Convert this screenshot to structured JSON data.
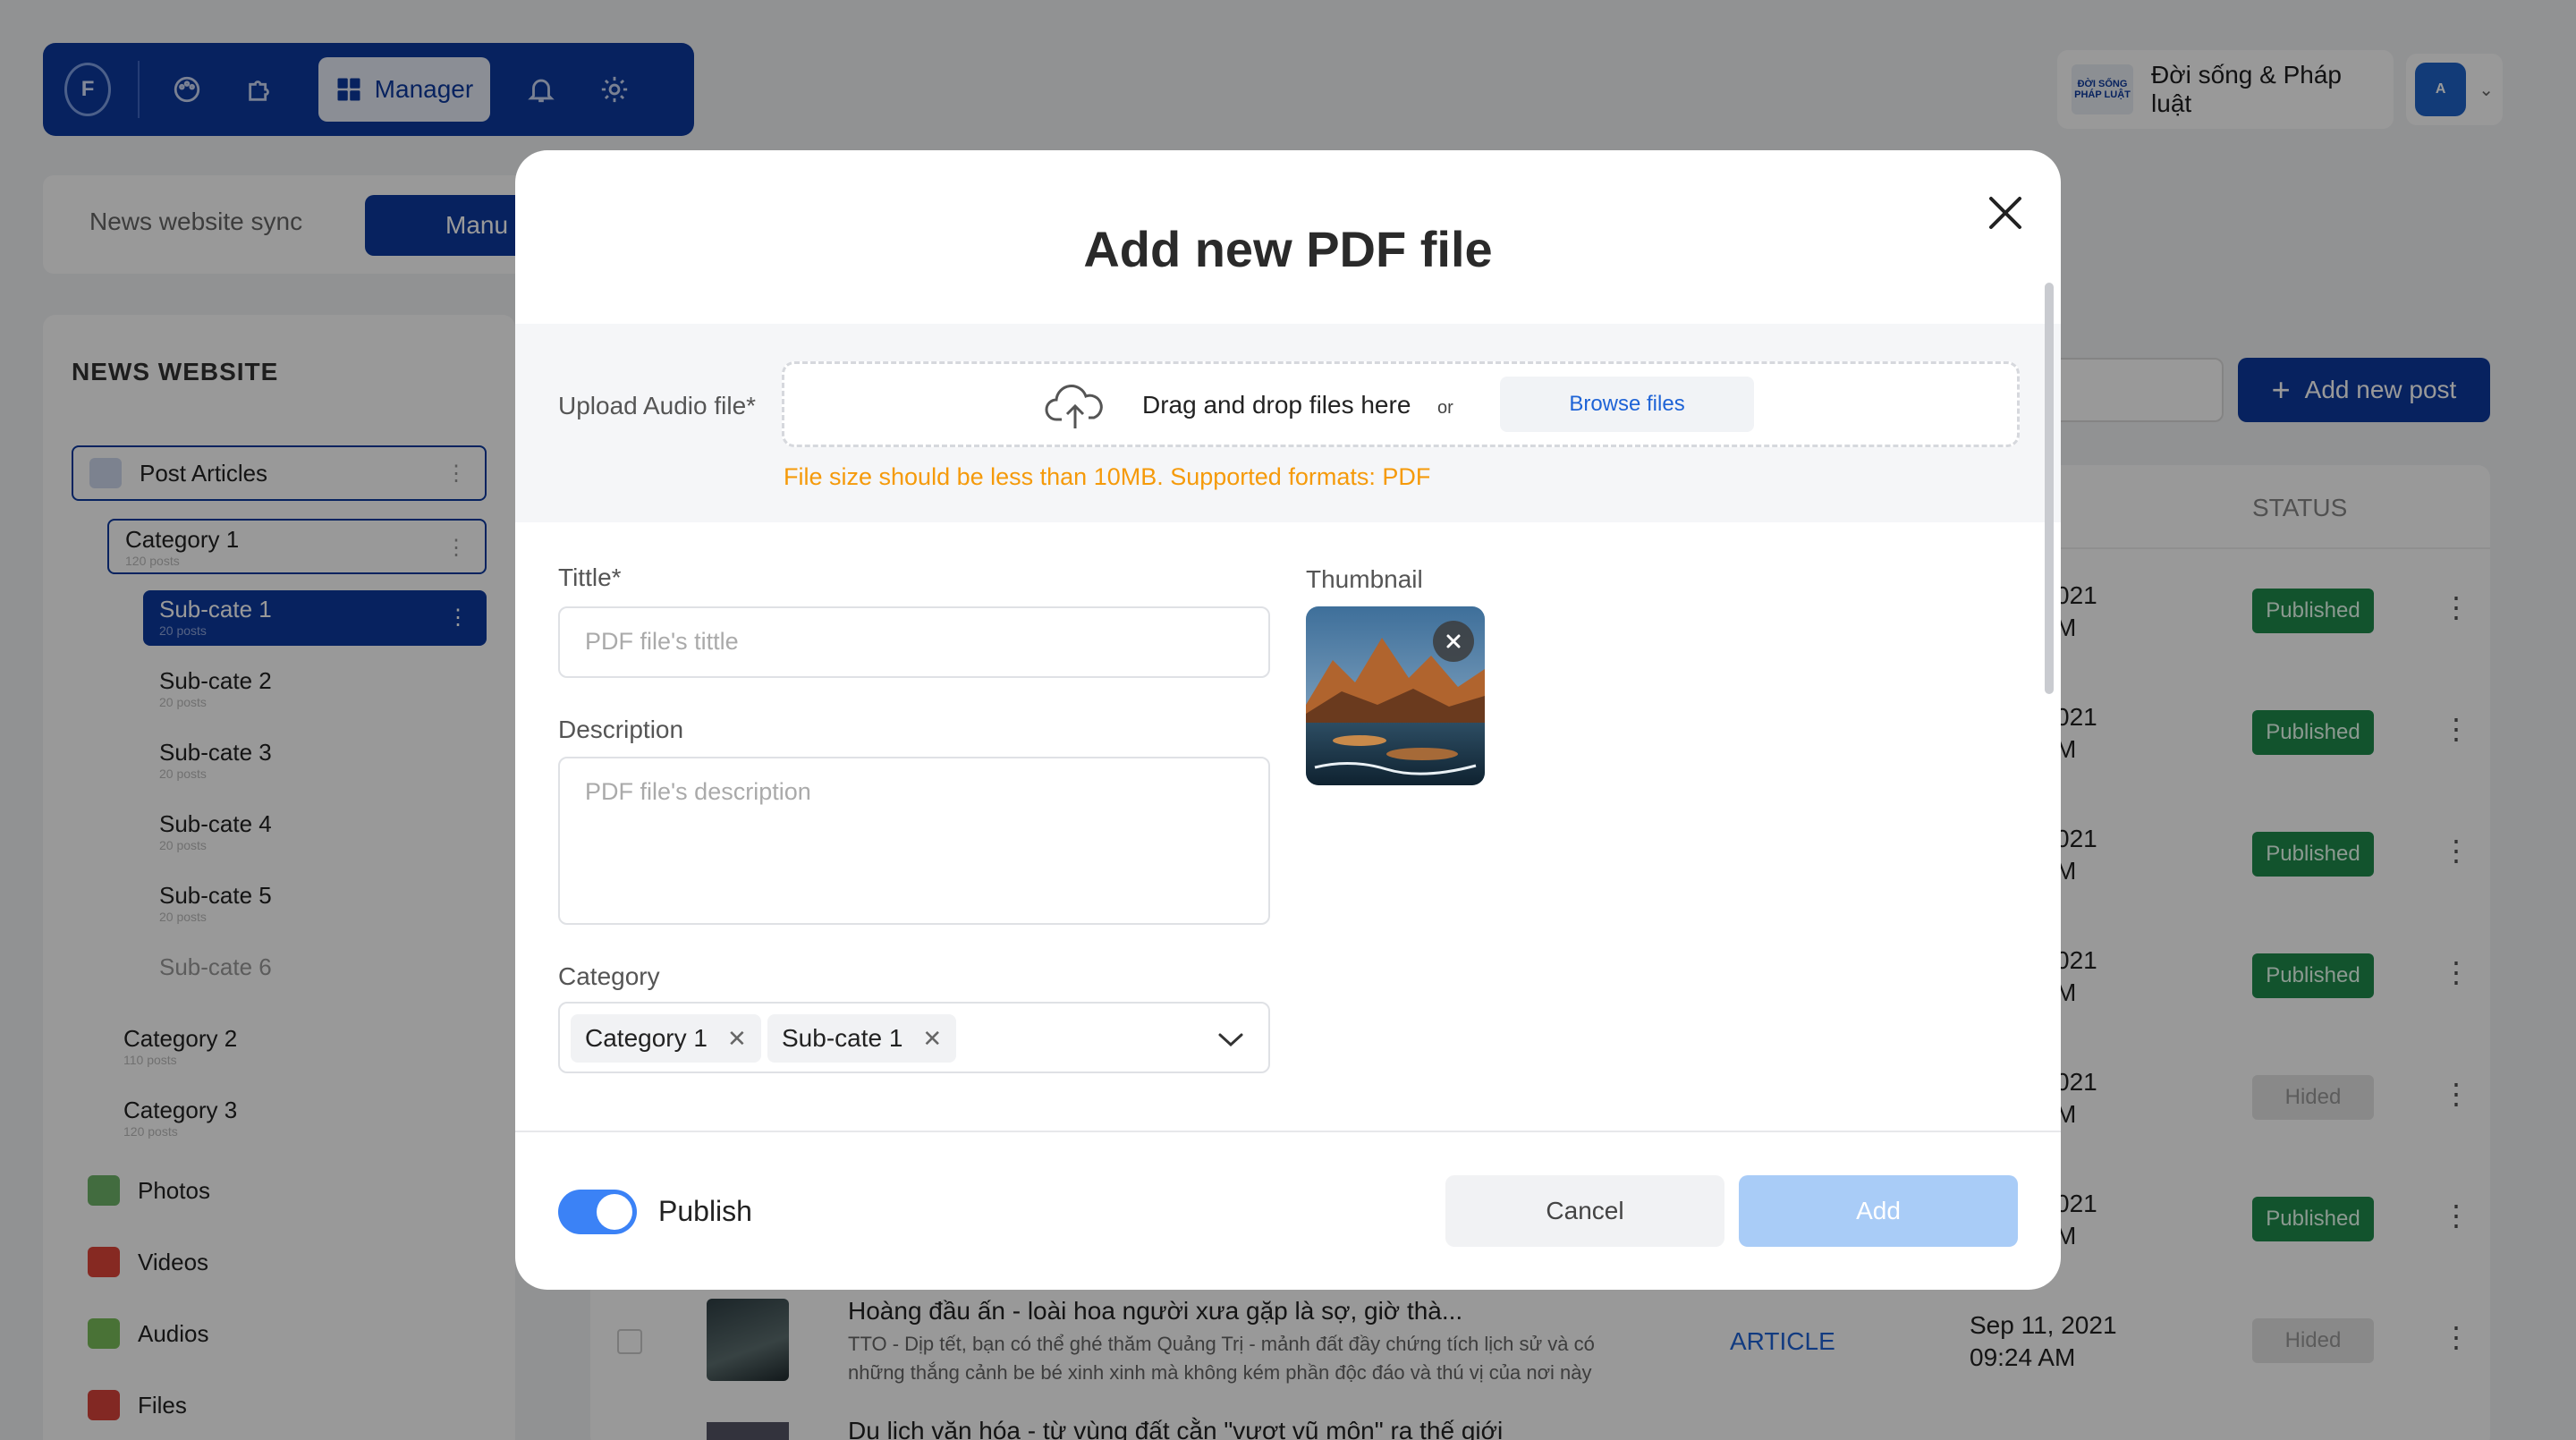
{
  "app": {
    "manager_label": "Manager",
    "brand_name": "Đời sống & Pháp luật",
    "brand_logo_text": "ĐỜI SỐNG PHÁP LUẬT"
  },
  "tabs": {
    "sync": "News website sync",
    "manual": "Manu"
  },
  "sidebar": {
    "heading": "NEWS WEBSITE",
    "items": [
      {
        "label": "Post Articles"
      },
      {
        "label": "Category 1",
        "sub": "120 posts"
      },
      {
        "label": "Sub-cate 1",
        "sub": "20 posts"
      },
      {
        "label": "Sub-cate 2",
        "sub": "20 posts"
      },
      {
        "label": "Sub-cate 3",
        "sub": "20 posts"
      },
      {
        "label": "Sub-cate 4",
        "sub": "20 posts"
      },
      {
        "label": "Sub-cate 5",
        "sub": "20 posts"
      },
      {
        "label": "Sub-cate 6"
      },
      {
        "label": "Category 2",
        "sub": "110 posts"
      },
      {
        "label": "Category 3",
        "sub": "120 posts"
      },
      {
        "label": "Photos"
      },
      {
        "label": "Videos"
      },
      {
        "label": "Audios"
      },
      {
        "label": "Files"
      }
    ]
  },
  "list": {
    "add_post": "Add new post",
    "status_header": "STATUS",
    "dates": [
      "021\nM",
      "021\nM",
      "021\nM",
      "021\nM",
      "021\nM",
      "021\nM"
    ],
    "statuses": [
      "Published",
      "Published",
      "Published",
      "Published",
      "Hided",
      "Published",
      "Hided"
    ],
    "row": {
      "title": "Hoàng đầu ấn - loài hoa người xưa gặp là sợ, giờ thà...",
      "excerpt_1": "TTO - Dịp tết, bạn có thể ghé thăm Quảng Trị - mảnh đất đầy chứng tích lịch sử và có",
      "excerpt_2": "những thắng cảnh be bé xinh xinh mà không kém phần độc đáo và thú vị của nơi này",
      "type": "ARTICLE",
      "date_1": "Sep 11, 2021",
      "date_2": "09:24 AM"
    },
    "row_next_title": "Du lịch văn hóa - từ vùng đất cằn \"vượt vũ môn\" ra thế giới"
  },
  "modal": {
    "title": "Add new PDF file",
    "upload_label": "Upload Audio file*",
    "drag_text": "Drag and drop files here",
    "or_text": "or",
    "browse_label": "Browse files",
    "hint": "File size should be less than 10MB. Supported formats: PDF",
    "title_label": "Tittle*",
    "title_placeholder": "PDF file's tittle",
    "desc_label": "Description",
    "desc_placeholder": "PDF file's description",
    "thumbnail_label": "Thumbnail",
    "category_label": "Category",
    "chips": [
      "Category 1",
      "Sub-cate 1"
    ],
    "publish_label": "Publish",
    "publish_on": true,
    "cancel_label": "Cancel",
    "add_label": "Add"
  },
  "colors": {
    "primary": "#0d3a9e",
    "hint": "#f59a0a",
    "toggle": "#3b82f6",
    "add_disabled": "#a9ccf7"
  }
}
